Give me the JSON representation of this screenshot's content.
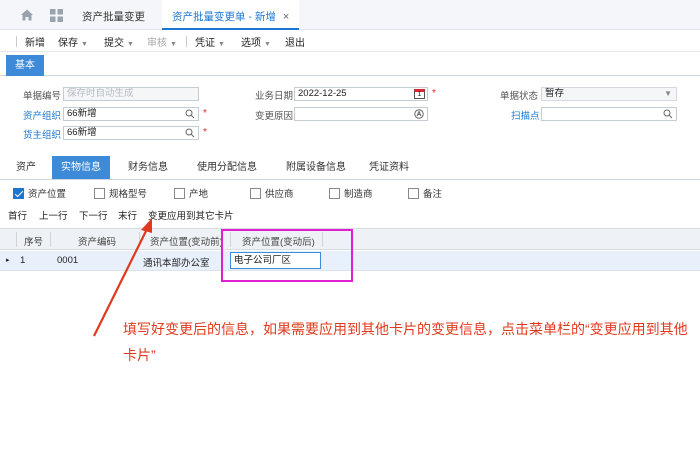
{
  "topbar": {
    "tab_list": "资产批量变更",
    "tab_active": "资产批量变更单 - 新增",
    "close_glyph": "×"
  },
  "toolbar": {
    "new": "新增",
    "save": "保存",
    "submit": "提交",
    "audit": "审核",
    "voucher": "凭证",
    "options": "选项",
    "exit": "退出"
  },
  "base_tab": "基本",
  "form": {
    "bill_no_label": "单据编号",
    "bill_no_placeholder": "保存时自动生成",
    "asset_org_label": "资产组织",
    "asset_org_value": "66新增",
    "owner_org_label": "货主组织",
    "owner_org_value": "66新增",
    "biz_date_label": "业务日期",
    "biz_date_value": "2022-12-25",
    "calendar_day": "1",
    "change_reason_label": "变更原因",
    "status_label": "单据状态",
    "status_value": "暂存",
    "scan_label": "扫描点",
    "required_mark": "*"
  },
  "subtabs": [
    "资产",
    "实物信息",
    "财务信息",
    "使用分配信息",
    "附属设备信息",
    "凭证资料"
  ],
  "checkboxes": [
    {
      "label": "资产位置",
      "checked": true
    },
    {
      "label": "规格型号",
      "checked": false
    },
    {
      "label": "产地",
      "checked": false
    },
    {
      "label": "供应商",
      "checked": false
    },
    {
      "label": "制造商",
      "checked": false
    },
    {
      "label": "备注",
      "checked": false
    }
  ],
  "rownav": {
    "first": "首行",
    "prev": "上一行",
    "next": "下一行",
    "last": "末行",
    "apply": "变更应用到其它卡片"
  },
  "grid": {
    "columns": [
      "序号",
      "资产编码",
      "资产位置(变动前)",
      "资产位置(变动后)"
    ],
    "row": {
      "indicator": "▸",
      "seq": "1",
      "code": "0001",
      "before": "通讯本部办公室",
      "after": "电子公司厂区"
    }
  },
  "annotation": "填写好变更后的信息，如果需要应用到其他卡片的变更信息，点击菜单栏的“变更应用到其他卡片”",
  "colors": {
    "accent": "#3c8ad8",
    "highlight": "#e020d0",
    "annotation": "#e03a1e"
  }
}
